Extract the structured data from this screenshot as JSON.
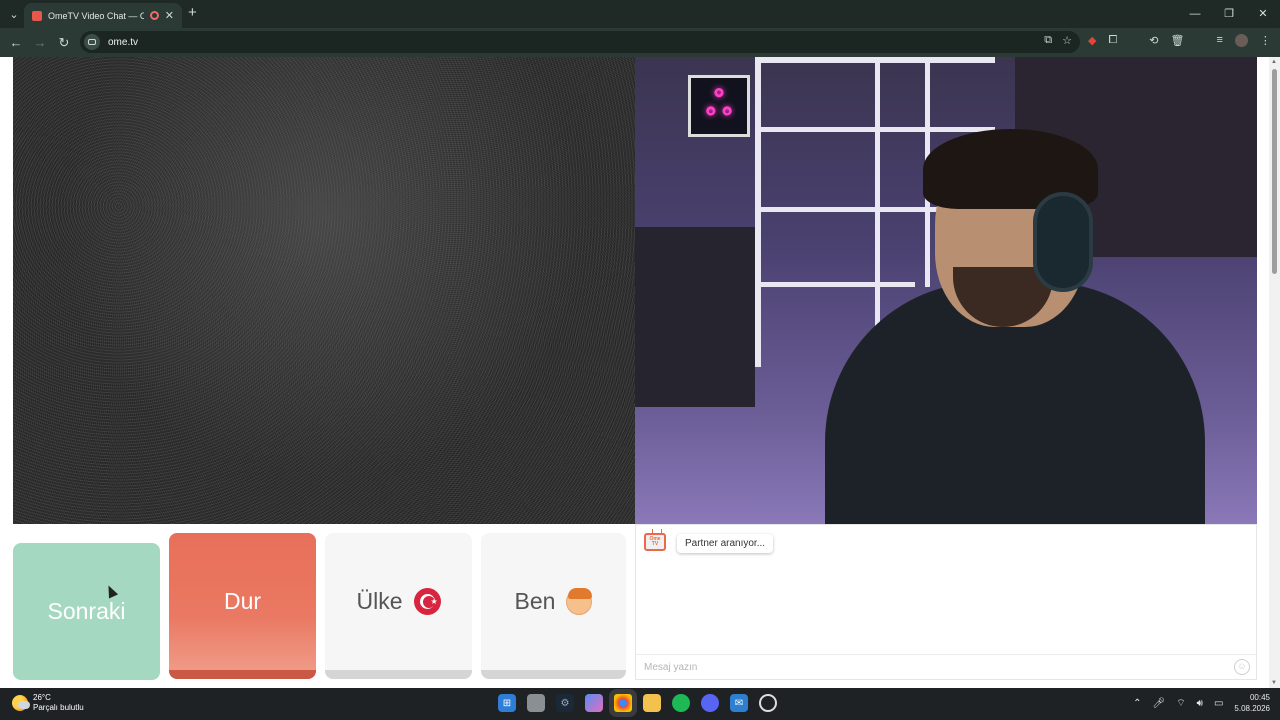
{
  "browser": {
    "tab_title": "OmeTV Video Chat — Omegle",
    "tab_close": "✕",
    "new_tab": "+",
    "url": "ome.tv",
    "nav": {
      "back": "←",
      "forward": "→",
      "reload": "↻"
    },
    "window_controls": {
      "minimize": "—",
      "restore": "❐",
      "close": "✕"
    }
  },
  "controls": {
    "next_label": "Sonraki",
    "stop_label": "Dur",
    "country_label": "Ülke",
    "me_label": "Ben"
  },
  "chat": {
    "logo_line1": "Ome",
    "logo_line2": "TV",
    "status_message": "Partner aranıyor...",
    "input_placeholder": "Mesaj yazın"
  },
  "taskbar": {
    "temperature": "26°C",
    "weather_desc": "Parçalı bulutlu",
    "time": "00:45",
    "date": "5.08.2026"
  },
  "colors": {
    "next": "#a4d8c0",
    "stop": "#e8705a",
    "neutral": "#f6f6f6"
  }
}
